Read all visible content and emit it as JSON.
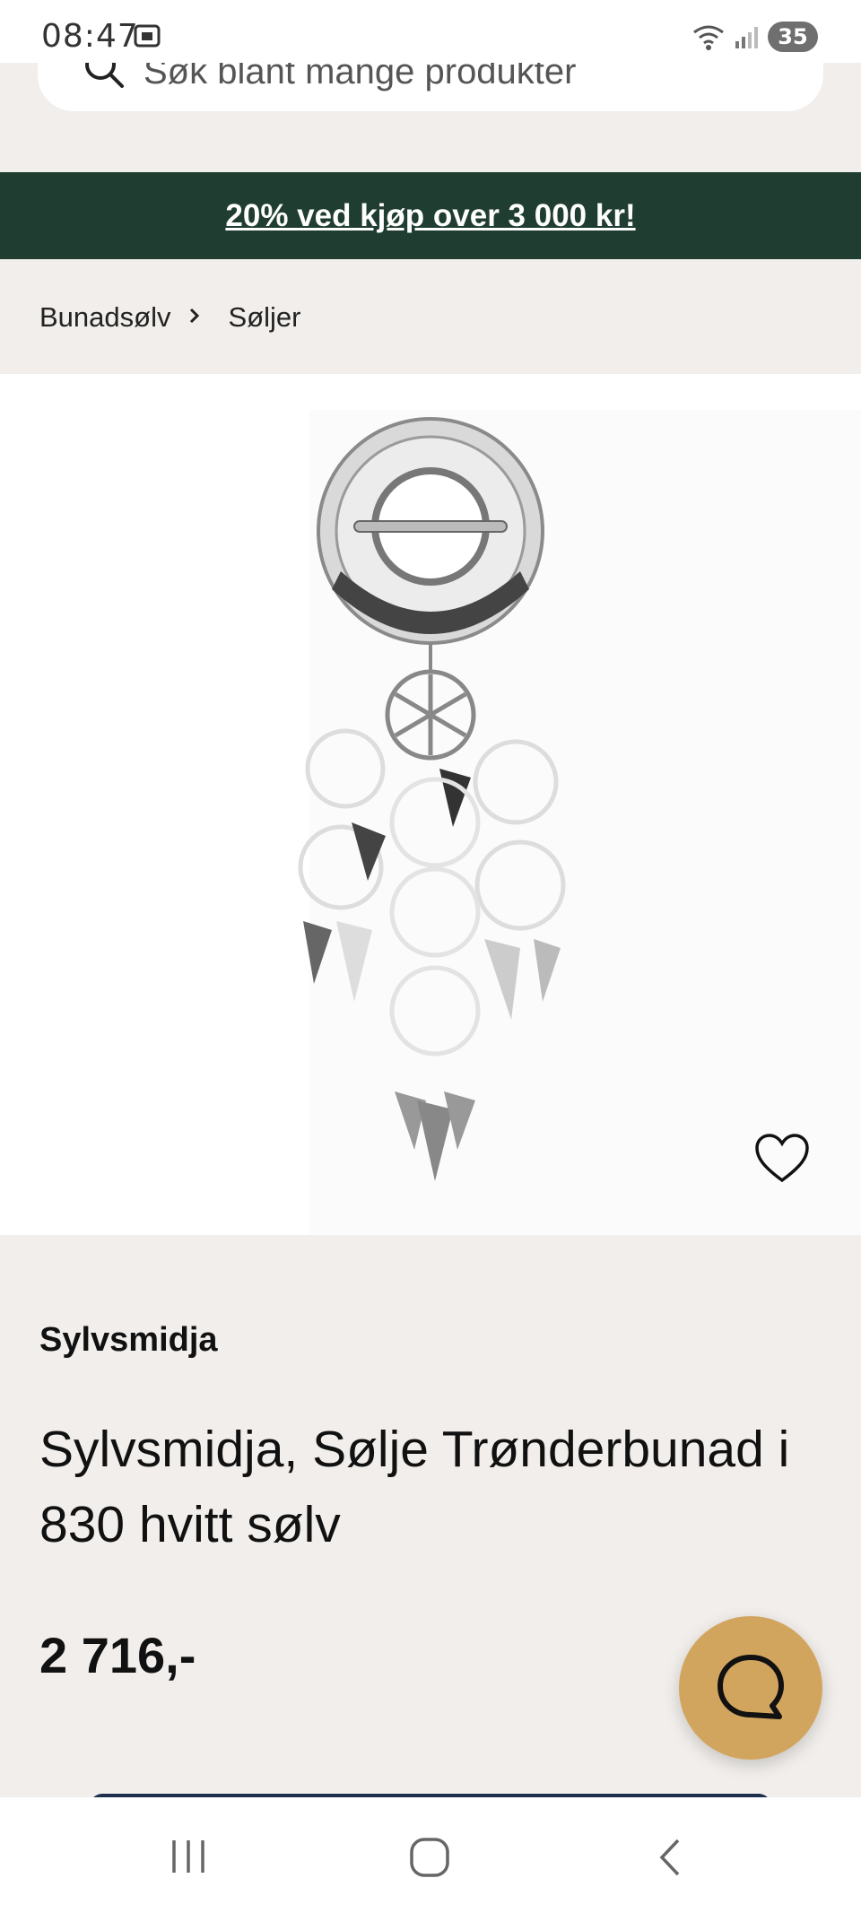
{
  "status_bar": {
    "time": "08:47",
    "battery": "35",
    "icons": [
      "screenshot-icon",
      "wifi-icon",
      "signal-icon",
      "battery-icon"
    ]
  },
  "search": {
    "placeholder": "Søk blant mange produkter"
  },
  "promo": {
    "text": "20% ved kjøp over 3 000 kr!",
    "background": "#1f3d30"
  },
  "breadcrumb": {
    "items": [
      "Bunadsølv",
      "Søljer"
    ]
  },
  "product": {
    "brand": "Sylvsmidja",
    "title": "Sylvsmidja, Sølje Trønderbunad i 830 hvitt sølv",
    "price": "2 716,-",
    "image_description_icon": "brooch-image"
  },
  "chat": {
    "icon": "chat-icon",
    "color": "#d2a55e"
  },
  "navigation": {
    "buttons": [
      "recent-apps-icon",
      "home-icon",
      "back-icon"
    ]
  }
}
